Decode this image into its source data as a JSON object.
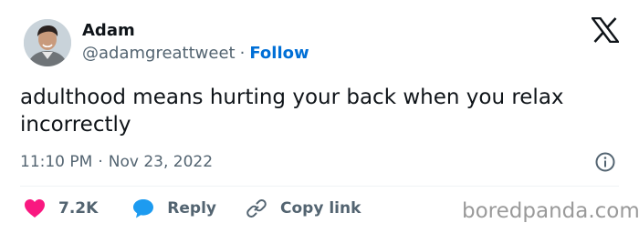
{
  "author": {
    "name": "Adam",
    "handle": "@adamgreattweet",
    "separator": "·",
    "follow_label": "Follow"
  },
  "tweet": {
    "text": "adulthood means hurting your back when you relax incorrectly",
    "time": "11:10 PM",
    "separator": "·",
    "date": "Nov 23, 2022"
  },
  "actions": {
    "like_count": "7.2K",
    "reply_label": "Reply",
    "copy_link_label": "Copy link"
  },
  "watermark": "boredpanda.com",
  "icons": {
    "brand": "x-logo-icon",
    "info": "info-icon",
    "like": "heart-icon",
    "reply": "speech-bubble-icon",
    "copy": "link-icon"
  },
  "colors": {
    "text": "#0f1419",
    "secondary": "#536471",
    "follow": "#006fd6",
    "like": "#f91880",
    "reply": "#1d9bf0",
    "divider": "#eff3f4"
  }
}
